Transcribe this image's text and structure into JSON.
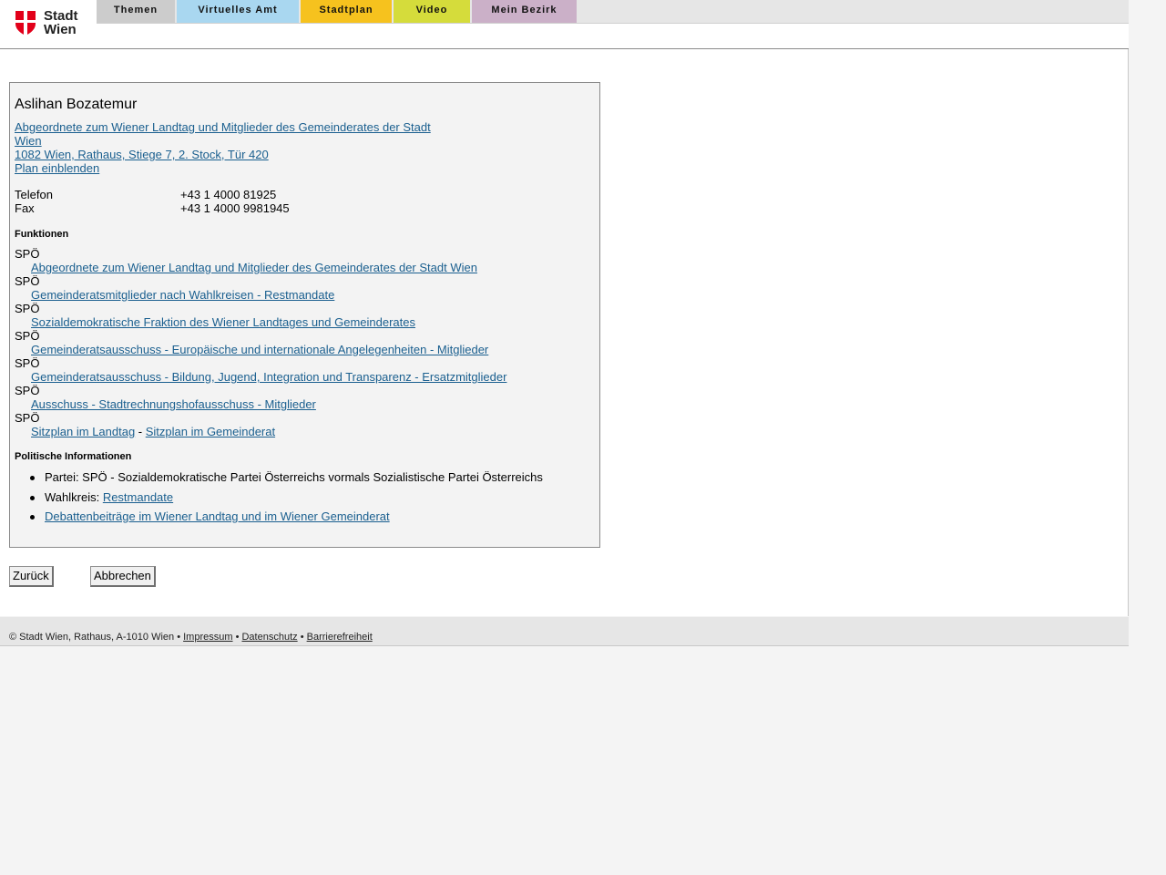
{
  "logo": {
    "line1": "Stadt",
    "line2": "Wien",
    "shield_color": "#e2001a"
  },
  "nav": {
    "tabs": [
      {
        "label": "Themen",
        "color": "#cccccc"
      },
      {
        "label": "Virtuelles Amt",
        "color": "#a9d7f0"
      },
      {
        "label": "Stadtplan",
        "color": "#f6c21e"
      },
      {
        "label": "Video",
        "color": "#d5dc3b"
      },
      {
        "label": "Mein Bezirk",
        "color": "#cbb0c8"
      }
    ]
  },
  "person": {
    "name": "Aslihan Bozatemur",
    "org_link": "Abgeordnete zum Wiener Landtag und Mitglieder des Gemeinderates der Stadt Wien",
    "address_link": "1082 Wien, Rathaus, Stiege 7, 2. Stock, Tür 420",
    "plan_link": "Plan einblenden",
    "telefon_label": "Telefon",
    "telefon_value": "+43 1 4000 81925",
    "fax_label": "Fax",
    "fax_value": "+43 1 4000 9981945"
  },
  "funktionen": {
    "heading": "Funktionen",
    "items": [
      {
        "party": "SPÖ",
        "link": "Abgeordnete zum Wiener Landtag und Mitglieder des Gemeinderates der Stadt Wien"
      },
      {
        "party": "SPÖ",
        "link": "Gemeinderatsmitglieder nach Wahlkreisen - Restmandate"
      },
      {
        "party": "SPÖ",
        "link": "Sozialdemokratische Fraktion des Wiener Landtages und Gemeinderates"
      },
      {
        "party": "SPÖ",
        "link": "Gemeinderatsausschuss - Europäische und internationale Angelegenheiten - Mitglieder"
      },
      {
        "party": "SPÖ",
        "link": "Gemeinderatsausschuss - Bildung, Jugend, Integration und Transparenz - Ersatzmitglieder"
      },
      {
        "party": "SPÖ",
        "link": "Ausschuss - Stadtrechnungshofausschuss - Mitglieder"
      },
      {
        "party": "SPÖ",
        "link": "Sitzplan im Landtag",
        "separator": " - ",
        "link2": "Sitzplan im Gemeinderat"
      }
    ]
  },
  "politisch": {
    "heading": "Politische Informationen",
    "partei_text": "Partei: SPÖ - Sozialdemokratische Partei Österreichs vormals Sozialistische Partei Österreichs",
    "wahlkreis_label": "Wahlkreis: ",
    "wahlkreis_link": "Restmandate",
    "debatten_link": "Debattenbeiträge im Wiener Landtag und im Wiener Gemeinderat"
  },
  "buttons": {
    "back": "Zurück",
    "cancel": "Abbrechen"
  },
  "footer": {
    "copyright": "© Stadt Wien, Rathaus, A-1010 Wien",
    "sep": " • ",
    "impressum": "Impressum",
    "datenschutz": "Datenschutz",
    "barrierefreiheit": "Barrierefreiheit"
  }
}
